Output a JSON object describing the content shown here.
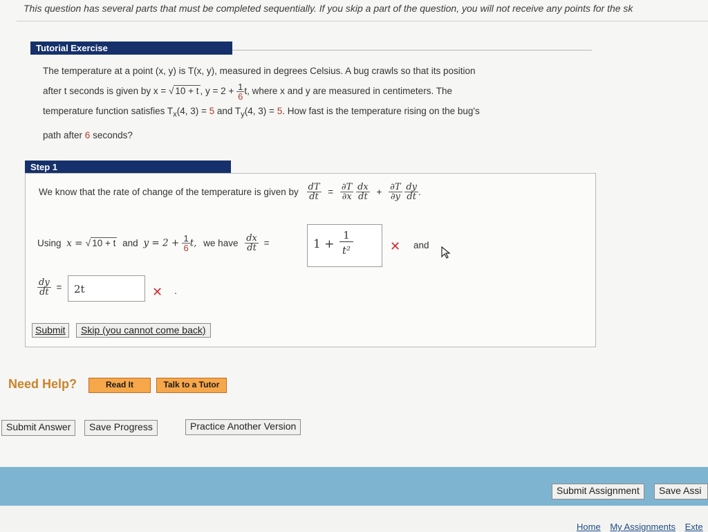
{
  "top_note": "This question has several parts that must be completed sequentially. If you skip a part of the question, you will not receive any points for the sk",
  "tutorial": {
    "header": "Tutorial Exercise",
    "line1": "The temperature at a point (x, y) is T(x, y), measured in degrees Celsius. A bug crawls so that its position",
    "line2_a": "after t seconds is given by x = ",
    "line2_sqrt": "10 + t",
    "line2_b": ", y = 2 + ",
    "line2_frac_num": "1",
    "line2_frac_den": "6",
    "line2_c": "t, where x and y are measured in centimeters. The",
    "line3_a": "temperature function satisfies T",
    "line3_sub1": "x",
    "line3_b": "(4, 3) = ",
    "line3_val1": "5",
    "line3_c": " and T",
    "line3_sub2": "y",
    "line3_d": "(4, 3) = ",
    "line3_val2": "5",
    "line3_e": ". How fast is the temperature rising on the bug's",
    "line4_a": "path after ",
    "line4_val": "6",
    "line4_b": " seconds?"
  },
  "step": {
    "header": "Step 1",
    "rate_text": "We know that the rate of change of the temperature is given by",
    "formula": {
      "dT": "dT",
      "dt": "dt",
      "eq": "=",
      "plus": "+",
      "pT": "∂T",
      "px": "∂x",
      "dx": "dx",
      "py": "∂y",
      "dy": "dy",
      "period": "."
    },
    "using_label": "Using",
    "using_x": "x = ",
    "using_sqrt": "10 + t",
    "using_and": "and",
    "using_y": "y = 2 + ",
    "using_frac_num": "1",
    "using_frac_den": "6",
    "using_t": "t,",
    "we_have": "we have",
    "dx_num": "dx",
    "dx_den": "dt",
    "eq": "=",
    "answer1_prefix": "1 +",
    "answer1_num": "1",
    "answer1_den": "t²",
    "and_label": "and",
    "dy_num": "dy",
    "dy_den": "dt",
    "answer2": "2t",
    "period": ".",
    "wrong_mark": "✕",
    "submit_label": "Submit",
    "skip_label": "Skip (you cannot come back)"
  },
  "help": {
    "title": "Need Help?",
    "read_it": "Read It",
    "talk_tutor": "Talk to a Tutor"
  },
  "actions": {
    "submit_answer": "Submit Answer",
    "save_progress": "Save Progress",
    "practice_another": "Practice Another Version"
  },
  "footer": {
    "submit_assignment": "Submit Assignment",
    "save_assignment": "Save Assi",
    "links": [
      "Home",
      "My Assignments",
      "Exte"
    ]
  }
}
